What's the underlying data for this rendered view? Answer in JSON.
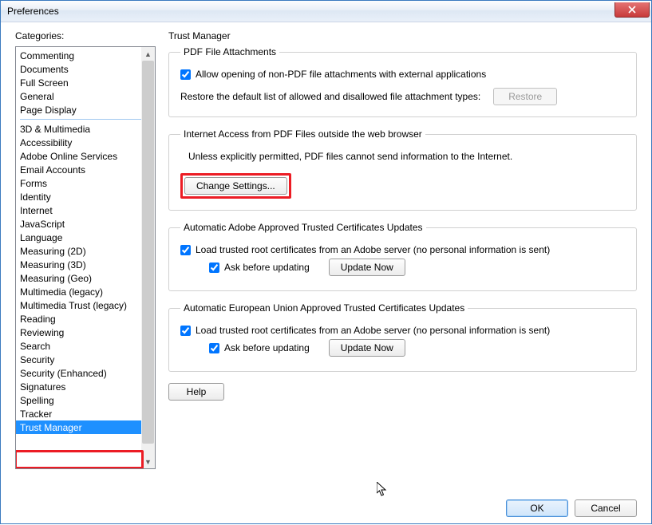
{
  "window": {
    "title": "Preferences"
  },
  "sidebar": {
    "label": "Categories:",
    "group_top": [
      "Commenting",
      "Documents",
      "Full Screen",
      "General",
      "Page Display"
    ],
    "group_main": [
      "3D & Multimedia",
      "Accessibility",
      "Adobe Online Services",
      "Email Accounts",
      "Forms",
      "Identity",
      "Internet",
      "JavaScript",
      "Language",
      "Measuring (2D)",
      "Measuring (3D)",
      "Measuring (Geo)",
      "Multimedia (legacy)",
      "Multimedia Trust (legacy)",
      "Reading",
      "Reviewing",
      "Search",
      "Security",
      "Security (Enhanced)",
      "Signatures",
      "Spelling",
      "Tracker",
      "Trust Manager"
    ],
    "selected": "Trust Manager"
  },
  "panel": {
    "title": "Trust Manager",
    "pdf_attach": {
      "legend": "PDF File Attachments",
      "allow_label": "Allow opening of non-PDF file attachments with external applications",
      "allow_checked": true,
      "restore_text": "Restore the default list of allowed and disallowed file attachment types:",
      "restore_btn": "Restore"
    },
    "internet": {
      "legend": "Internet Access from PDF Files outside the web browser",
      "desc": "Unless explicitly permitted, PDF files cannot send information to the Internet.",
      "change_btn": "Change Settings..."
    },
    "adobe_cert": {
      "legend": "Automatic Adobe Approved Trusted Certificates Updates",
      "load_label": "Load trusted root certificates from an Adobe server (no personal information is sent)",
      "load_checked": true,
      "ask_label": "Ask before updating",
      "ask_checked": true,
      "update_btn": "Update Now"
    },
    "eu_cert": {
      "legend": "Automatic European Union Approved Trusted Certificates Updates",
      "load_label": "Load trusted root certificates from an Adobe server (no personal information is sent)",
      "load_checked": true,
      "ask_label": "Ask before updating",
      "ask_checked": true,
      "update_btn": "Update Now"
    },
    "help_btn": "Help"
  },
  "footer": {
    "ok": "OK",
    "cancel": "Cancel"
  }
}
